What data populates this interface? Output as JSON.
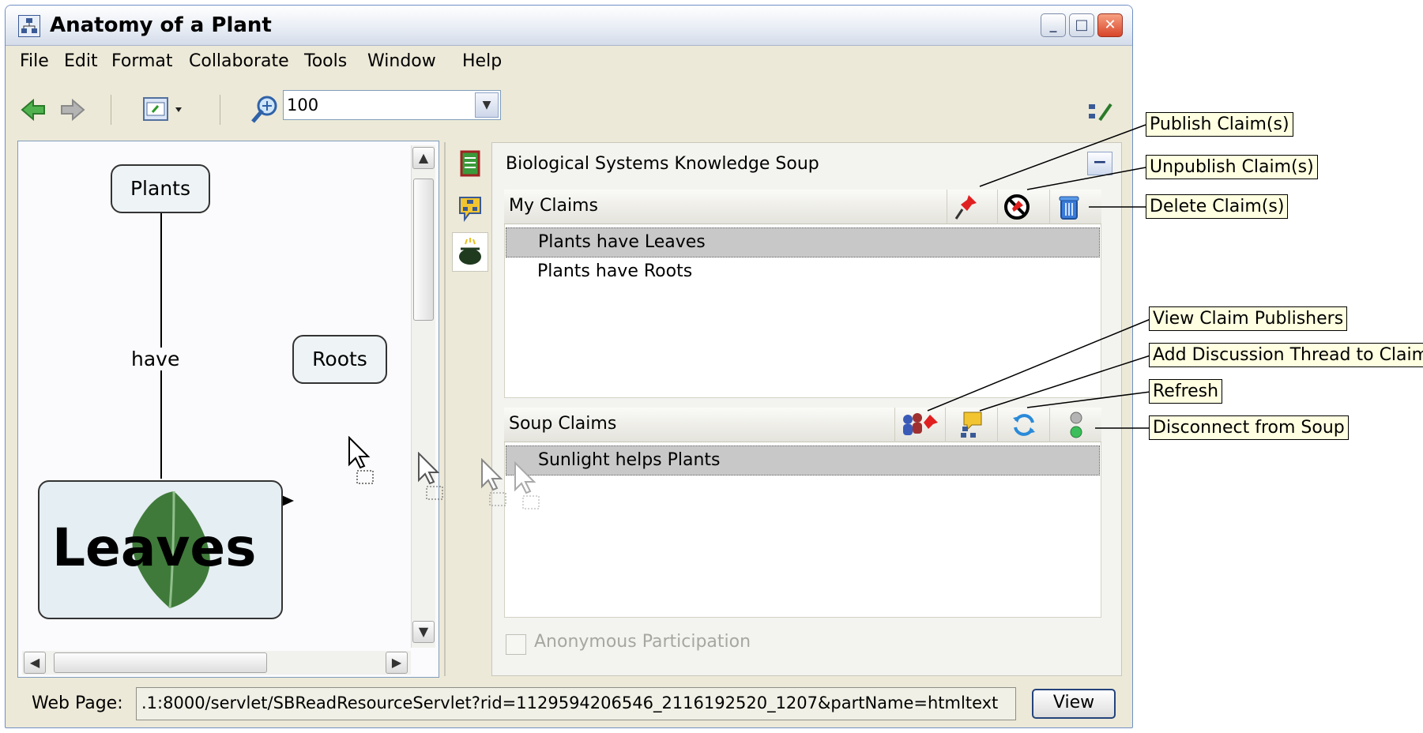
{
  "window": {
    "title": "Anatomy of a Plant"
  },
  "menu": [
    "File",
    "Edit",
    "Format",
    "Collaborate",
    "Tools",
    "Window",
    "Help"
  ],
  "toolbar": {
    "zoom_value": "100"
  },
  "concept_map": {
    "nodes": {
      "plants": "Plants",
      "roots": "Roots",
      "leaves": "Leaves"
    },
    "link_label": "have"
  },
  "soup": {
    "title": "Biological Systems Knowledge Soup",
    "collapse_label": "−",
    "my_claims": {
      "header": "My Claims",
      "items": [
        "Plants have Leaves",
        "Plants have Roots"
      ],
      "selected_index": 0
    },
    "soup_claims": {
      "header": "Soup Claims",
      "items": [
        "Sunlight helps Plants"
      ],
      "selected_index": 0
    },
    "anonymous_label": "Anonymous Participation",
    "anonymous_checked": false
  },
  "bottom": {
    "label": "Web Page:",
    "url": ".1:8000/servlet/SBReadResourceServlet?rid=1129594206546_2116192520_1207&partName=htmltext",
    "view_button": "View"
  },
  "callouts": {
    "publish": "Publish Claim(s)",
    "unpublish": "Unpublish Claim(s)",
    "delete": "Delete Claim(s)",
    "view_publishers": "View Claim Publishers",
    "add_thread": "Add Discussion Thread to Claim",
    "refresh": "Refresh",
    "disconnect": "Disconnect from Soup"
  },
  "icons": {
    "publish": "pushpin-icon",
    "unpublish": "unpublish-icon",
    "delete": "trash-icon",
    "view_publishers": "publishers-icon",
    "add_thread": "discussion-thread-icon",
    "refresh": "refresh-icon",
    "disconnect": "disconnect-icon"
  },
  "colors": {
    "title_bar": "#e7ecf4",
    "selection": "#c8c8c8",
    "callout_bg": "#ffffe1",
    "window_bg": "#ece9d8"
  }
}
